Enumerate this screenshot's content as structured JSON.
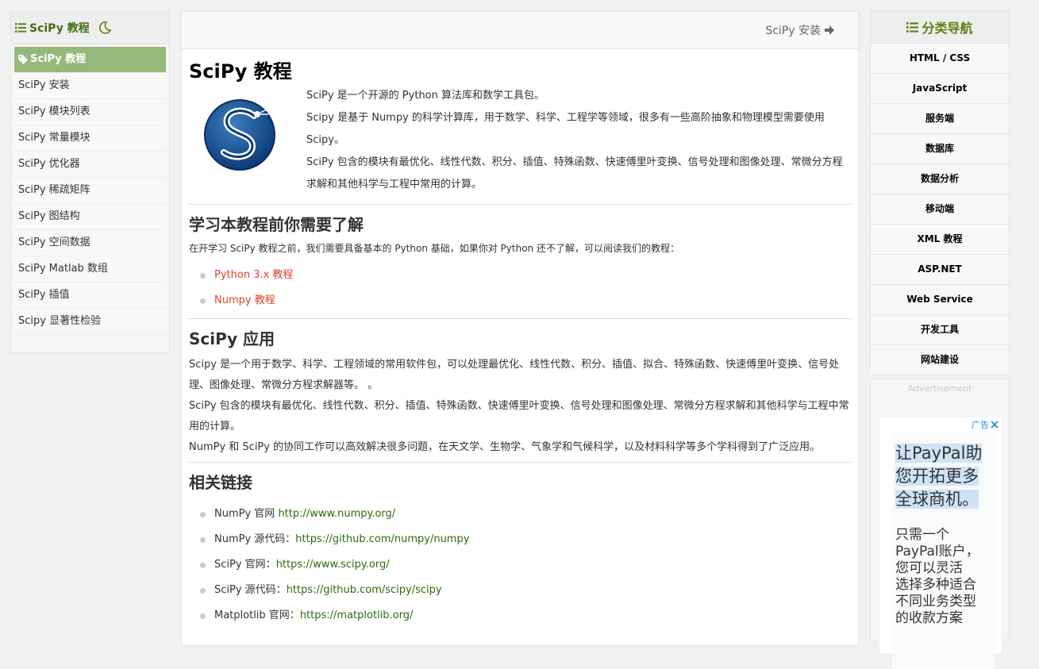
{
  "left_sidebar": {
    "title": "SciPy 教程",
    "items": [
      {
        "label": "SciPy 教程"
      },
      {
        "label": "SciPy 安装"
      },
      {
        "label": "SciPy 模块列表"
      },
      {
        "label": "SciPy 常量模块"
      },
      {
        "label": "SciPy 优化器"
      },
      {
        "label": "SciPy 稀疏矩阵"
      },
      {
        "label": "SciPy 图结构"
      },
      {
        "label": "SciPy 空间数据"
      },
      {
        "label": "SciPy Matlab 数组"
      },
      {
        "label": "SciPy 插值"
      },
      {
        "label": "Scipy 显著性检验"
      }
    ]
  },
  "topbar": {
    "next_label": "SciPy 安装"
  },
  "main": {
    "title": "SciPy 教程",
    "intro": [
      "SciPy 是一个开源的 Python 算法库和数学工具包。",
      "Scipy 是基于 Numpy 的科学计算库，用于数学、科学、工程学等领域，很多有一些高阶抽象和物理模型需要使用 Scipy。",
      "SciPy 包含的模块有最优化、线性代数、积分、插值、特殊函数、快速傅里叶变换、信号处理和图像处理、常微分方程求解和其他科学与工程中常用的计算。"
    ],
    "prereq": {
      "heading": "学习本教程前你需要了解",
      "text": "在开学习 SciPy 教程之前，我们需要具备基本的 Python 基础，如果你对 Python 还不了解，可以阅读我们的教程：",
      "links": [
        "Python 3.x 教程",
        "Numpy 教程"
      ]
    },
    "apps": {
      "heading": "SciPy 应用",
      "paragraphs": [
        "Scipy 是一个用于数学、科学、工程领域的常用软件包，可以处理最优化、线性代数、积分、插值、拟合、特殊函数、快速傅里叶变换、信号处理、图像处理、常微分方程求解器等。 。",
        "SciPy 包含的模块有最优化、线性代数、积分、插值、特殊函数、快速傅里叶变换、信号处理和图像处理、常微分方程求解和其他科学与工程中常用的计算。",
        "NumPy 和 SciPy 的协同工作可以高效解决很多问题，在天文学、生物学、气象学和气候科学，以及材料科学等多个学科得到了广泛应用。"
      ]
    },
    "related": {
      "heading": "相关链接",
      "items": [
        {
          "label": "NumPy 官网 ",
          "url": "http://www.numpy.org/"
        },
        {
          "label": "NumPy 源代码：",
          "url": "https://github.com/numpy/numpy"
        },
        {
          "label": "SciPy 官网：",
          "url": "https://www.scipy.org/"
        },
        {
          "label": "SciPy 源代码：",
          "url": "https://github.com/scipy/scipy"
        },
        {
          "label": "Matplotlib 官网：",
          "url": "https://matplotlib.org/"
        }
      ]
    }
  },
  "right_sidebar": {
    "title": "分类导航",
    "items": [
      "HTML / CSS",
      "JavaScript",
      "服务端",
      "数据库",
      "数据分析",
      "移动端",
      "XML 教程",
      "ASP.NET",
      "Web Service",
      "开发工具",
      "网站建设"
    ]
  },
  "ad": {
    "label": "Advertisement",
    "badge": "广告",
    "headline": [
      "让PayPal助",
      "您开拓更多",
      "全球商机。"
    ],
    "body": [
      "只需一个",
      "PayPal账户，",
      "您可以灵活",
      "选择多种适合",
      "不同业务类型",
      "的收款方案"
    ]
  },
  "colors": {
    "accent_green": "#96b97b",
    "heading_green": "#617f10",
    "link_red": "#d9462b",
    "link_green": "#276e0a"
  }
}
